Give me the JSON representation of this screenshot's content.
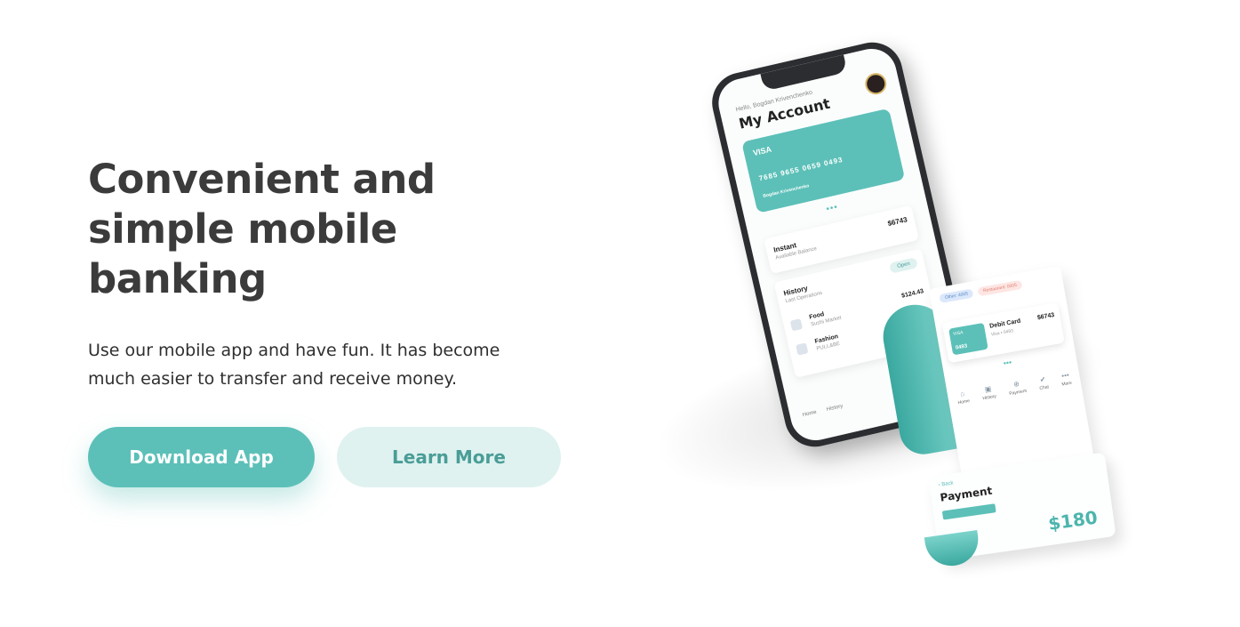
{
  "hero": {
    "title": "Convenient and simple mobile banking",
    "subtitle": "Use our mobile app and have fun. It has become much easier to transfer and receive money."
  },
  "buttons": {
    "download_label": "Download App",
    "learn_label": "Learn More"
  },
  "colors": {
    "accent": "#5cc0b8",
    "accent_light": "#dff2f0",
    "title": "#3b3b3b"
  },
  "phone": {
    "greeting": "Hello, Bogdan Krivenchenko",
    "title": "My Account",
    "card": {
      "brand": "VISA",
      "number": "7685 9655 0659 0493",
      "holder": "Bogdan Krivenchenko"
    },
    "balance": {
      "name": "Instant",
      "sub": "Available Balance",
      "amount": "$6743"
    },
    "history": {
      "title": "History",
      "sub": "Last Operations",
      "open": "Open",
      "rows": [
        {
          "category": "Food",
          "merchant": "Sushi Market",
          "amount": "$124.43"
        },
        {
          "category": "Fashion",
          "merchant": "PULL&BE",
          "amount": ""
        }
      ]
    },
    "nav": [
      "Home",
      "History"
    ]
  },
  "receipt": {
    "tags": [
      "Other: 4005",
      "Restaurant: 0005",
      ""
    ],
    "card_brand": "VISA",
    "card_digits": "0493",
    "card_name": "Debit Card",
    "card_sub": "Visa • 0493",
    "card_amount": "$6743",
    "nav": [
      {
        "label": "Home",
        "icon": "home-icon"
      },
      {
        "label": "History",
        "icon": "history-icon"
      },
      {
        "label": "Payment",
        "icon": "payment-icon"
      },
      {
        "label": "Chat",
        "icon": "chat-icon"
      },
      {
        "label": "More",
        "icon": "more-icon"
      }
    ],
    "back": "Back",
    "payment_title": "Payment",
    "payment_amount": "$180"
  }
}
